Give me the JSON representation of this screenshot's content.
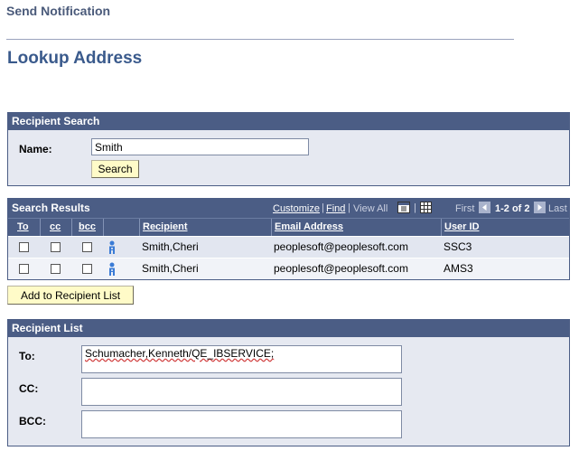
{
  "page": {
    "header": "Send Notification",
    "title": "Lookup Address"
  },
  "recipient_search": {
    "title": "Recipient Search",
    "name_label": "Name:",
    "name_value": "Smith",
    "search_button": "Search"
  },
  "search_results": {
    "title": "Search Results",
    "nav": {
      "customize": "Customize",
      "sep": "|",
      "find": "Find",
      "view_all": "View All",
      "first": "First",
      "range": "1-2 of 2",
      "last": "Last"
    },
    "columns": {
      "to": "To",
      "cc": "cc",
      "bcc": "bcc",
      "recipient": "Recipient",
      "email": "Email Address",
      "userid": "User ID"
    },
    "rows": [
      {
        "to": false,
        "cc": false,
        "bcc": false,
        "recipient": "Smith,Cheri",
        "email": "peoplesoft@peoplesoft.com",
        "userid": "SSC3"
      },
      {
        "to": false,
        "cc": false,
        "bcc": false,
        "recipient": "Smith,Cheri",
        "email": "peoplesoft@peoplesoft.com",
        "userid": "AMS3"
      }
    ]
  },
  "add_button": "Add to Recipient List",
  "recipient_list": {
    "title": "Recipient List",
    "to_label": "To:",
    "to_value": "Schumacher,Kenneth/QE_IBSERVICE;",
    "cc_label": "CC:",
    "cc_value": "",
    "bcc_label": "BCC:",
    "bcc_value": ""
  },
  "colors": {
    "header_bar": "#4b5d85",
    "group_body": "#e6e9f1",
    "button_bg": "#fffbc8",
    "title_text": "#3a5a8c"
  }
}
